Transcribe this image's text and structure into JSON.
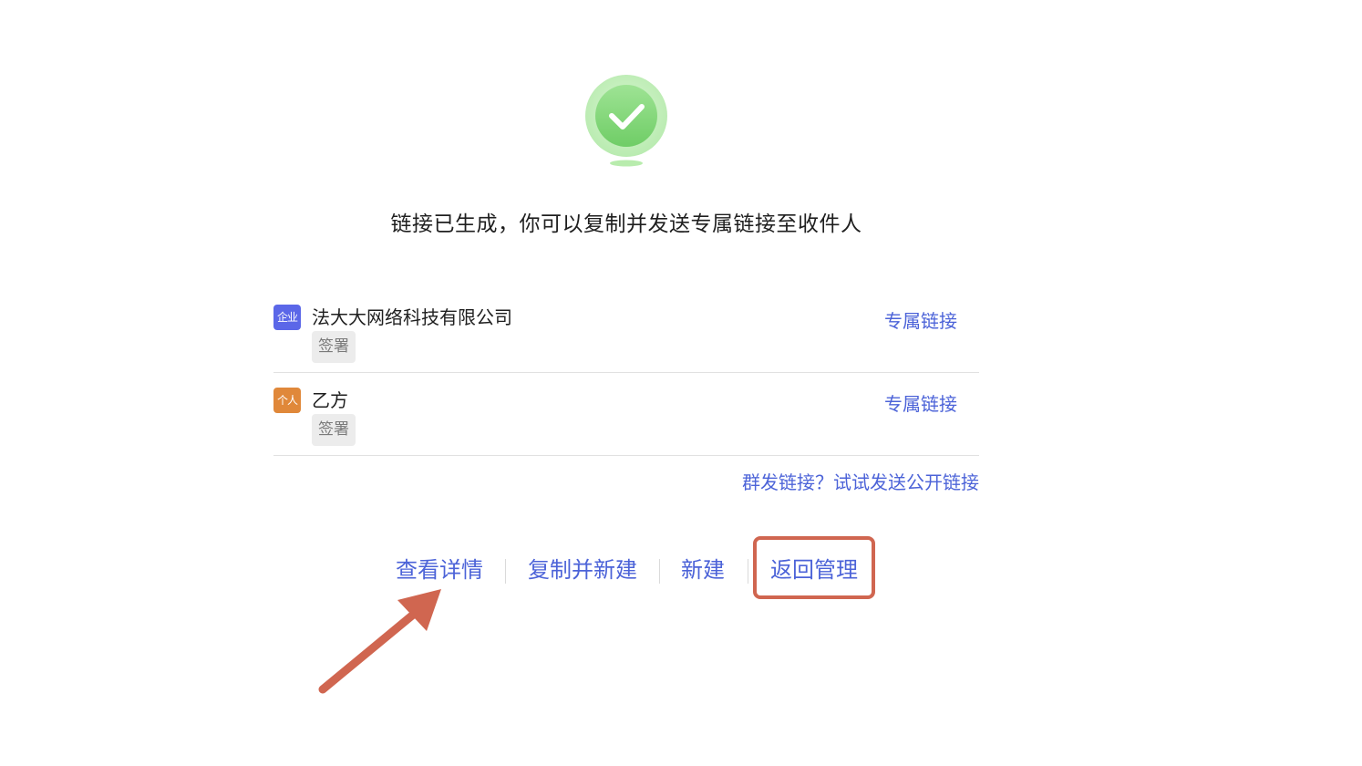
{
  "result": {
    "headline": "链接已生成，你可以复制并发送专属链接至收件人"
  },
  "signers": [
    {
      "type_badge": "企业",
      "type_color": "#5b67e8",
      "name": "法大大网络科技有限公司",
      "action_tag": "签署",
      "link_label": "专属链接"
    },
    {
      "type_badge": "个人",
      "type_color": "#e0883a",
      "name": "乙方",
      "action_tag": "签署",
      "link_label": "专属链接"
    }
  ],
  "public_link_hint": "群发链接？试试发送公开链接",
  "actions": {
    "view_details": "查看详情",
    "copy_and_new": "复制并新建",
    "new": "新建",
    "back_to_manage": "返回管理"
  },
  "colors": {
    "link": "#4c63d8",
    "success_green": "#7ed67a",
    "annotation": "#d06650"
  },
  "annotations": {
    "highlighted_action": "返回管理",
    "arrow_points_to": "查看详情"
  }
}
